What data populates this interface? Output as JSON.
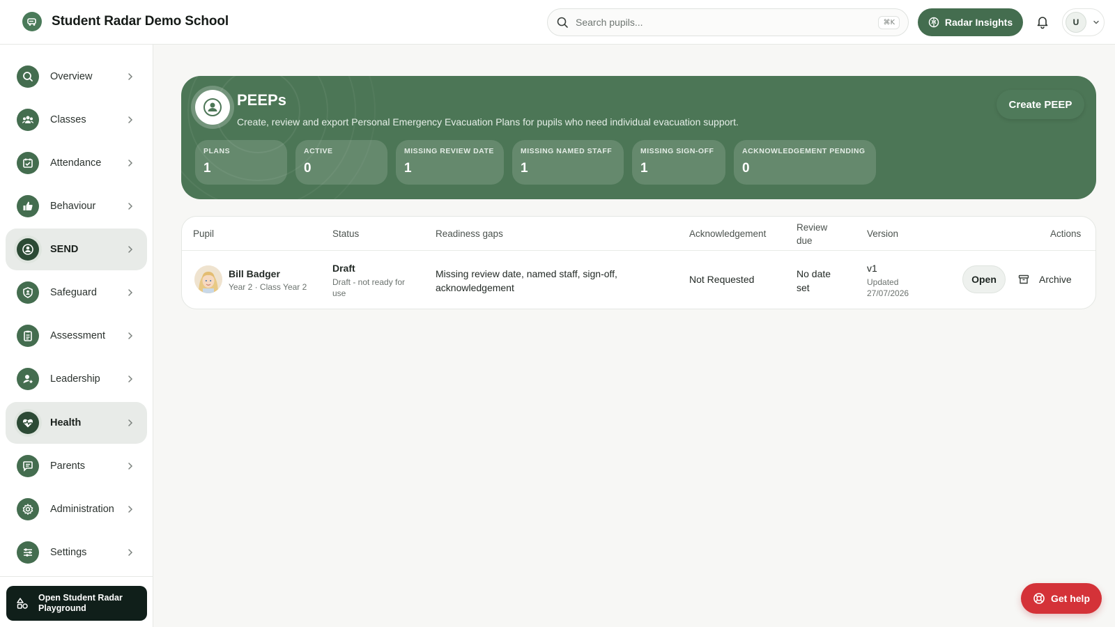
{
  "app": {
    "title": "Student Radar Demo School",
    "accent_color": "#446d4f",
    "danger_color": "#d43238"
  },
  "header": {
    "search_placeholder": "Search pupils...",
    "search_shortcut": "⌘K",
    "insights_label": "Radar Insights",
    "user_initial": "U"
  },
  "sidebar": {
    "items": [
      {
        "label": "Overview",
        "icon": "search-icon",
        "active": false
      },
      {
        "label": "Classes",
        "icon": "users-icon",
        "active": false
      },
      {
        "label": "Attendance",
        "icon": "calendar-check-icon",
        "active": false
      },
      {
        "label": "Behaviour",
        "icon": "thumbs-up-icon",
        "active": false
      },
      {
        "label": "SEND",
        "icon": "person-circle-icon",
        "active": true
      },
      {
        "label": "Safeguard",
        "icon": "shield-icon",
        "active": false
      },
      {
        "label": "Assessment",
        "icon": "clipboard-icon",
        "active": false
      },
      {
        "label": "Leadership",
        "icon": "user-star-icon",
        "active": false
      },
      {
        "label": "Health",
        "icon": "heart-pulse-icon",
        "active": true
      },
      {
        "label": "Parents",
        "icon": "chat-icon",
        "active": false
      },
      {
        "label": "Administration",
        "icon": "gear-icon",
        "active": false
      },
      {
        "label": "Settings",
        "icon": "sliders-icon",
        "active": false
      }
    ],
    "playground_label": "Open Student Radar Playground"
  },
  "hero": {
    "title": "PEEPs",
    "subtitle": "Create, review and export Personal Emergency Evacuation Plans for pupils who need individual evacuation support.",
    "create_label": "Create PEEP",
    "stats": [
      {
        "label": "PLANS",
        "value": "1"
      },
      {
        "label": "ACTIVE",
        "value": "0"
      },
      {
        "label": "MISSING REVIEW DATE",
        "value": "1"
      },
      {
        "label": "MISSING NAMED STAFF",
        "value": "1"
      },
      {
        "label": "MISSING SIGN-OFF",
        "value": "1"
      },
      {
        "label": "ACKNOWLEDGEMENT PENDING",
        "value": "0"
      }
    ]
  },
  "table": {
    "columns": {
      "pupil": "Pupil",
      "status": "Status",
      "gaps": "Readiness gaps",
      "ack": "Acknowledgement",
      "review": "Review due",
      "version": "Version",
      "actions": "Actions"
    },
    "rows": [
      {
        "name": "Bill Badger",
        "meta": "Year 2 · Class Year 2",
        "status": "Draft",
        "status_note": "Draft - not ready for use",
        "gaps": "Missing review date, named staff, sign-off, acknowledgement",
        "ack": "Not Requested",
        "review": "No date set",
        "version": "v1",
        "updated": "Updated 27/07/2026",
        "open_label": "Open",
        "archive_label": "Archive"
      }
    ]
  },
  "help": {
    "label": "Get help"
  }
}
